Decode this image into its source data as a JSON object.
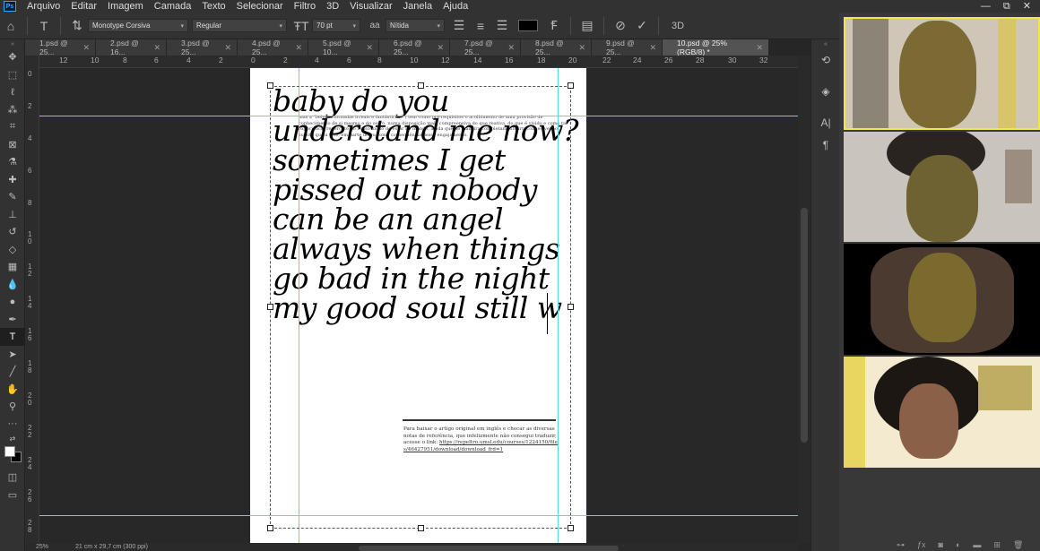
{
  "menu": [
    "Arquivo",
    "Editar",
    "Imagem",
    "Camada",
    "Texto",
    "Selecionar",
    "Filtro",
    "3D",
    "Visualizar",
    "Janela",
    "Ajuda"
  ],
  "window_controls": {
    "minimize": "—",
    "restore": "⧉",
    "close": "✕"
  },
  "options": {
    "font_family": "Monotype Corsiva",
    "font_style": "Regular",
    "font_size": "70 pt",
    "aa_glyph": "aa",
    "antialias": "Nítida",
    "threeD": "3D",
    "text_color": "#000000"
  },
  "tabs": [
    {
      "label": "1.psd @ 25..."
    },
    {
      "label": "2.psd @ 16..."
    },
    {
      "label": "3.psd @ 25..."
    },
    {
      "label": "4.psd @ 25..."
    },
    {
      "label": "5.psd @ 10..."
    },
    {
      "label": "6.psd @ 25..."
    },
    {
      "label": "7.psd @ 25..."
    },
    {
      "label": "8.psd @ 25..."
    },
    {
      "label": "9.psd @ 25..."
    },
    {
      "label": "10.psd @ 25% (RGB/8) *"
    }
  ],
  "ruler_h": [
    "12",
    "10",
    "8",
    "6",
    "4",
    "2",
    "0",
    "2",
    "4",
    "6",
    "8",
    "10",
    "12",
    "14",
    "16",
    "18",
    "20",
    "22",
    "24",
    "26",
    "28",
    "30",
    "32"
  ],
  "ruler_v": [
    "0",
    "2",
    "4",
    "6",
    "8",
    "1\n0",
    "1\n2",
    "1\n4",
    "1\n6",
    "1\n8",
    "2\n0",
    "2\n2",
    "2\n4",
    "2\n6",
    "2\n8"
  ],
  "document": {
    "poem_lines": [
      "baby do you",
      "understand me now?",
      "sometimes I get",
      "pissed out nobody",
      "can be an angel",
      "always when things",
      "go bad in the night",
      "my good soul still w"
    ],
    "background_paragraph": "mas a \"belezas tornadas irreais e fantásticas\" ') tem como pré-requisitos o acolhimento de uma provisão de conhecimento de si mesmo e do outro, numa disposição mais compreensiva do que reativa, do que é vivido e como tal experiência repercute no nosso modo de estar no mundo, ainda que de maneira completamente irreconhecível ao sujeito que a vive, em parte do eu como consequência desse engajamento.",
    "footnote": "Para baixar o artigo original em inglês e checar as diversas notas de referência, que infelizmente não consegui traduzir, acesse o link:",
    "footnote_link": "https://repeltro.umsl.edu/courses/1224150/files/46427951/download/download_frd=1"
  },
  "status": {
    "zoom": "25%",
    "doc_size": "21 cm x 29,7 cm (300 ppi)"
  }
}
